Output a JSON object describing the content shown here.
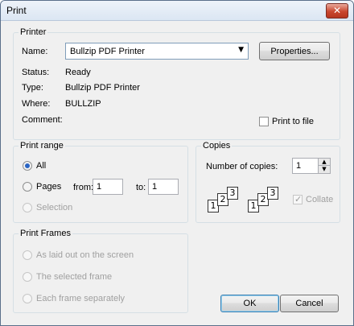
{
  "window": {
    "title": "Print",
    "close_icon": "close-icon"
  },
  "printer": {
    "group_title": "Printer",
    "name_label": "Name:",
    "name_value": "Bullzip PDF Printer",
    "properties_label": "Properties...",
    "status_label": "Status:",
    "status_value": "Ready",
    "type_label": "Type:",
    "type_value": "Bullzip PDF Printer",
    "where_label": "Where:",
    "where_value": "BULLZIP",
    "comment_label": "Comment:",
    "print_to_file_label": "Print to file",
    "print_to_file_checked": false
  },
  "print_range": {
    "group_title": "Print range",
    "all_label": "All",
    "pages_label": "Pages",
    "from_label": "from:",
    "from_value": "1",
    "to_label": "to:",
    "to_value": "1",
    "selection_label": "Selection",
    "selected": "All"
  },
  "copies": {
    "group_title": "Copies",
    "number_label": "Number of copies:",
    "number_value": "1",
    "collate_label": "Collate",
    "collate_checked": true,
    "collate_enabled": false,
    "collate_icon_digits_1": [
      "1",
      "2",
      "3"
    ],
    "collate_icon_digits_2": [
      "1",
      "2",
      "3"
    ]
  },
  "print_frames": {
    "group_title": "Print Frames",
    "options": [
      "As laid out on the screen",
      "The selected frame",
      "Each frame separately"
    ],
    "enabled": false
  },
  "buttons": {
    "ok": "OK",
    "cancel": "Cancel"
  },
  "colors": {
    "radio_accent": "#2a65c4",
    "disabled_text": "#a0a0a0"
  }
}
